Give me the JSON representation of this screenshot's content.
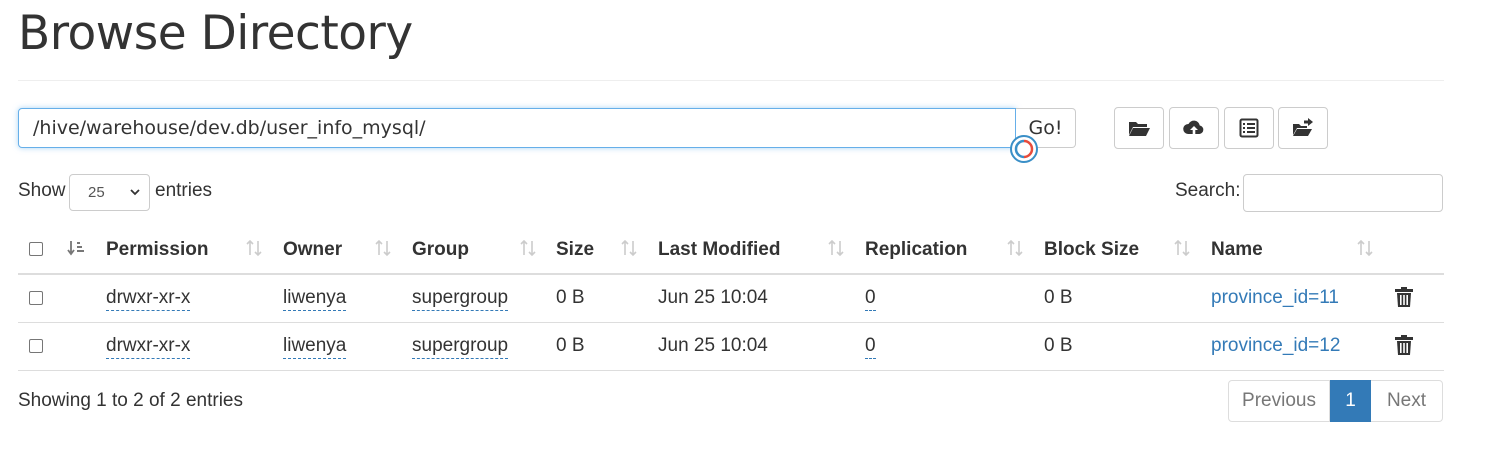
{
  "page": {
    "title": "Browse Directory"
  },
  "pathbar": {
    "path": "/hive/warehouse/dev.db/user_info_mysql/",
    "go_label": "Go!"
  },
  "toolbar": {
    "buttons": [
      {
        "icon": "folder-open-icon"
      },
      {
        "icon": "cloud-upload-icon"
      },
      {
        "icon": "list-alt-icon"
      },
      {
        "icon": "folder-move-icon"
      }
    ]
  },
  "length": {
    "show_label": "Show",
    "selected": "25",
    "entries_label": "entries"
  },
  "search": {
    "label": "Search:",
    "value": ""
  },
  "table": {
    "columns": [
      "Permission",
      "Owner",
      "Group",
      "Size",
      "Last Modified",
      "Replication",
      "Block Size",
      "Name"
    ],
    "rows": [
      {
        "permission": "drwxr-xr-x",
        "owner": "liwenya",
        "group": "supergroup",
        "size": "0 B",
        "last_modified": "Jun 25 10:04",
        "replication": "0",
        "block_size": "0 B",
        "name": "province_id=11"
      },
      {
        "permission": "drwxr-xr-x",
        "owner": "liwenya",
        "group": "supergroup",
        "size": "0 B",
        "last_modified": "Jun 25 10:04",
        "replication": "0",
        "block_size": "0 B",
        "name": "province_id=12"
      }
    ]
  },
  "footer": {
    "info": "Showing 1 to 2 of 2 entries",
    "pagination": {
      "previous": "Previous",
      "current": "1",
      "next": "Next"
    }
  },
  "colors": {
    "accent": "#337ab7",
    "focus": "#66afe9",
    "border": "#dddddd"
  }
}
